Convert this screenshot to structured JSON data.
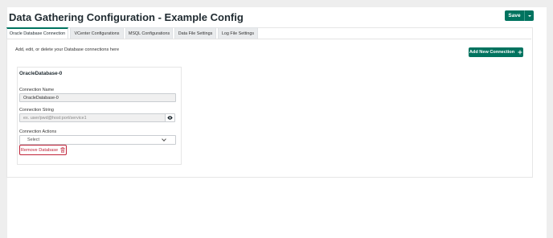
{
  "page": {
    "title": "Data Gathering Configuration - Example Config"
  },
  "toolbar": {
    "save_label": "Save"
  },
  "tabs": [
    {
      "label": "Oracle Database Connection",
      "active": true
    },
    {
      "label": "VCenter Configurations",
      "active": false
    },
    {
      "label": "MSQL Configurations",
      "active": false
    },
    {
      "label": "Data File Settings",
      "active": false
    },
    {
      "label": "Log File Settings",
      "active": false
    }
  ],
  "main": {
    "hint": "Add, edit, or delete your Database connections here",
    "add_button_label": "Add New Connection",
    "connection": {
      "title": "OracleDatabase-0",
      "name_label": "Connection Name",
      "name_value": "OracleDatabase-0",
      "string_label": "Connection String",
      "string_placeholder": "ex. user/pwd@host:port/service1",
      "actions_label": "Connection Actions",
      "actions_selected": "Select",
      "remove_label": "Remove Database"
    }
  },
  "colors": {
    "accent": "#00735f",
    "danger": "#c0243a"
  },
  "icons": [
    "plus-icon",
    "eye-icon",
    "chevron-down-icon",
    "trash-icon",
    "caret-down-icon"
  ]
}
